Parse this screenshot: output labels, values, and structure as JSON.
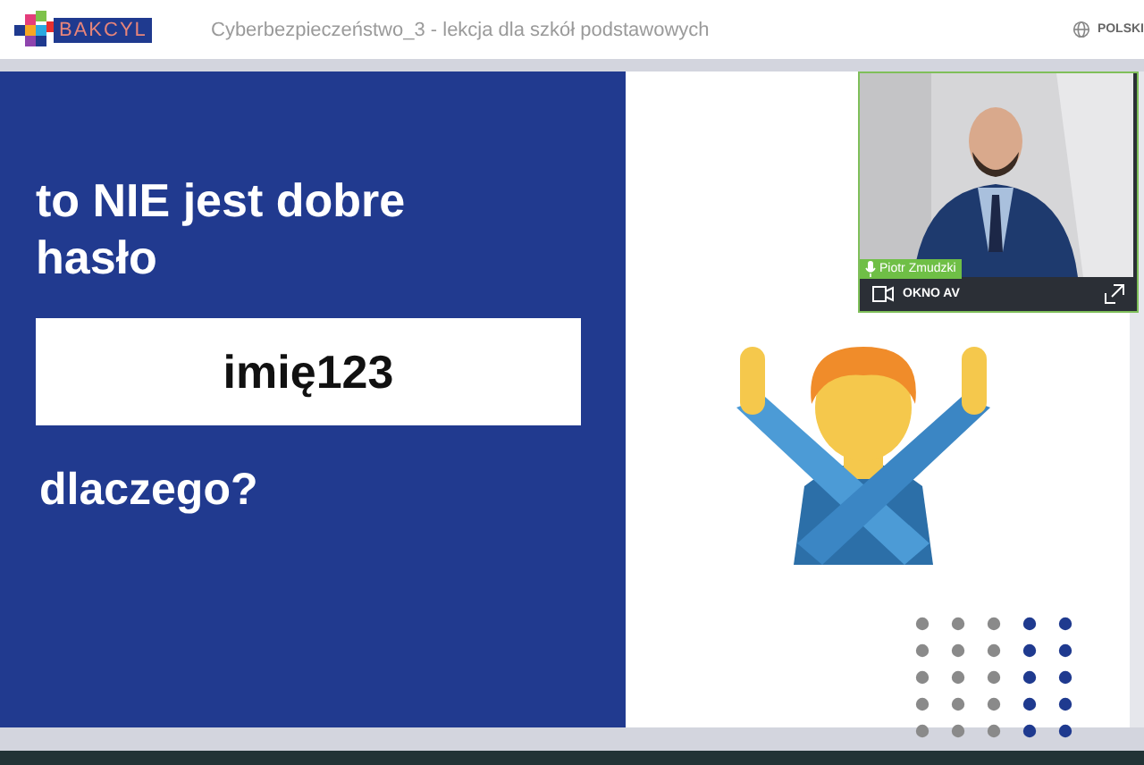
{
  "header": {
    "logo_text": "BAKCYL",
    "title": "Cyberbezpieczeństwo_3 - lekcja dla szkół podstawowych",
    "language": "POLSKI"
  },
  "slide": {
    "heading": "to NIE jest dobre hasło",
    "example": "imię123",
    "question": "dlaczego?"
  },
  "video": {
    "speaker": "Piotr Zmudzki",
    "label": "OKNO AV"
  }
}
